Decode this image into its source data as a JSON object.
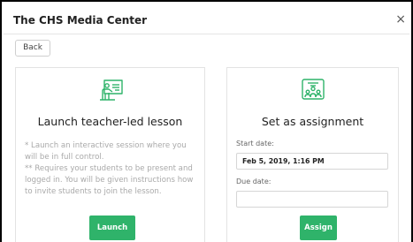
{
  "dialog": {
    "title": "The CHS Media Center",
    "back_label": "Back"
  },
  "colors": {
    "accent": "#2fb36a",
    "border": "#000000"
  },
  "teacher_led": {
    "icon": "presenter-board-icon",
    "title": "Launch teacher-led lesson",
    "description": [
      "* Launch an interactive session where you will be in full control.",
      "** Requires your students to be present and logged in. You will be given instructions how to invite students to join the lesson."
    ],
    "button_label": "Launch"
  },
  "assignment": {
    "icon": "classroom-icon",
    "title": "Set as assignment",
    "start_label": "Start date:",
    "start_value": "Feb 5, 2019, 1:16 PM",
    "due_label": "Due date:",
    "due_value": "",
    "button_label": "Assign"
  }
}
